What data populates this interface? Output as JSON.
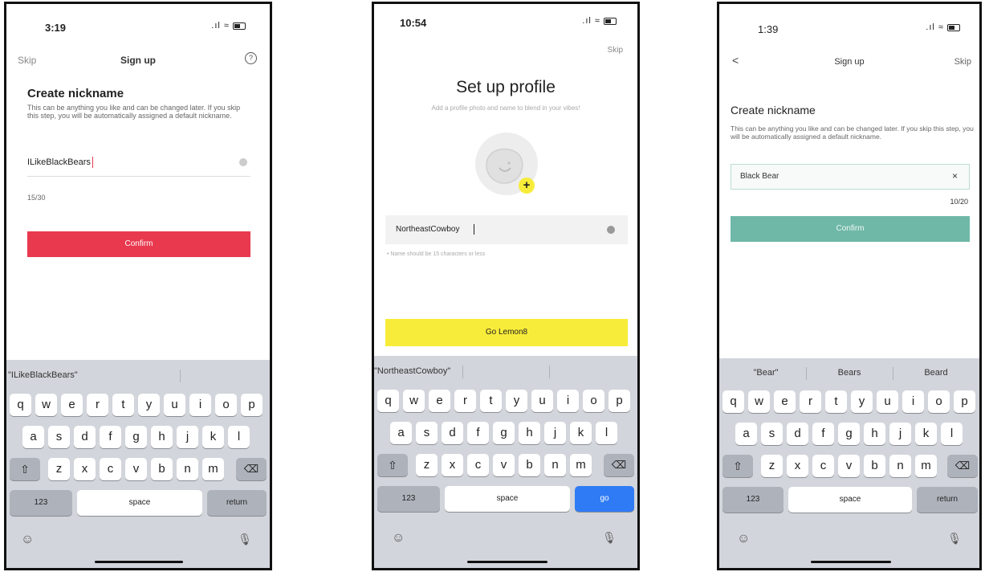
{
  "screen1": {
    "time": "3:19",
    "skip": "Skip",
    "title": "Sign up",
    "help_icon": "?",
    "heading": "Create nickname",
    "description": "This can be anything you like and can be changed later. If you skip this step, you will be automatically assigned a default nickname.",
    "input_value": "ILikeBlackBears",
    "counter": "15/30",
    "confirm": "Confirm",
    "confirm_color": "#e8394f",
    "suggestion": "\"ILikeBlackBears\""
  },
  "screen2": {
    "time": "10:54",
    "skip": "Skip",
    "heading": "Set up profile",
    "subtitle": "Add a profile photo and name to blend in your vibes!",
    "input_value": "NortheastCowboy",
    "hint": "• Name should be 15 characters or less",
    "go_button": "Go Lemon8",
    "go_color": "#f8ec3a",
    "suggestion": "\"NortheastCowboy\"",
    "return_key": "go"
  },
  "screen3": {
    "time": "1:39",
    "back": "<",
    "title": "Sign up",
    "skip": "Skip",
    "heading": "Create nickname",
    "description": "This can be anything you like and can be changed later. If you skip this step, you will be automatically assigned a default nickname.",
    "input_value": "Black Bear",
    "counter": "10/20",
    "confirm": "Confirm",
    "confirm_color": "#6fb8a8",
    "suggestions": [
      "\"Bear\"",
      "Bears",
      "Beard"
    ],
    "return_key": "return"
  },
  "keyboard": {
    "row1": [
      "q",
      "w",
      "e",
      "r",
      "t",
      "y",
      "u",
      "i",
      "o",
      "p"
    ],
    "row2": [
      "a",
      "s",
      "d",
      "f",
      "g",
      "h",
      "j",
      "k",
      "l"
    ],
    "row3": [
      "z",
      "x",
      "c",
      "v",
      "b",
      "n",
      "m"
    ],
    "shift": "⇧",
    "delete": "⌫",
    "numbers": "123",
    "space": "space",
    "return": "return",
    "emoji": "☺",
    "mic": "🎙"
  }
}
